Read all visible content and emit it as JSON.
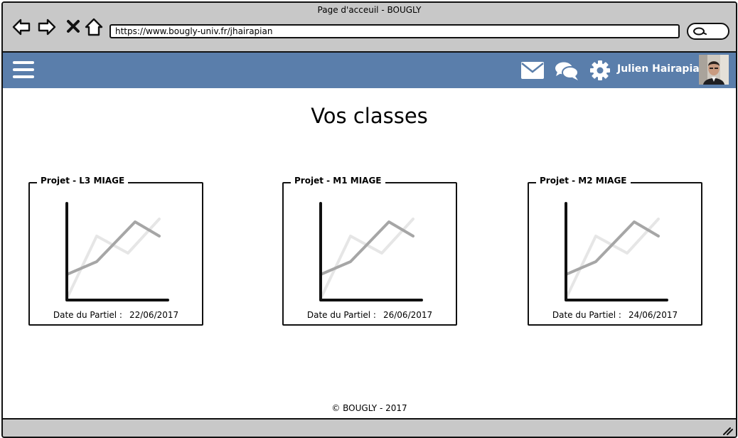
{
  "window": {
    "title": "Page d'acceuil - BOUGLY"
  },
  "browser": {
    "url": "https://www.bougly-univ.fr/jhairapian",
    "icons": [
      "back-arrow-icon",
      "forward-arrow-icon",
      "close-icon",
      "home-icon",
      "search-icon"
    ]
  },
  "header": {
    "icons": [
      "menu-icon",
      "mail-icon",
      "chat-icon",
      "gear-icon"
    ],
    "user_name": "Julien Hairapian",
    "brand_color": "#5a7eab"
  },
  "main": {
    "title": "Vos classes",
    "date_label": "Date du Partiel :",
    "cards": [
      {
        "title": "Projet - L3 MIAGE",
        "date": "22/06/2017"
      },
      {
        "title": "Projet - M1 MIAGE",
        "date": "26/06/2017"
      },
      {
        "title": "Projet - M2 MIAGE",
        "date": "24/06/2017"
      }
    ]
  },
  "footer": {
    "text": "© BOUGLY - 2017"
  }
}
